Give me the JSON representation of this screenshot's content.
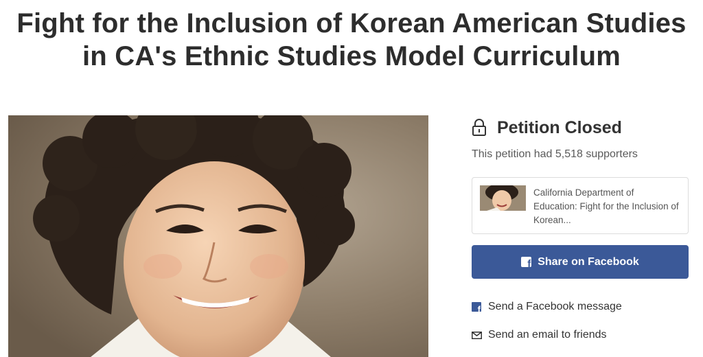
{
  "page": {
    "title_line_1": "Fight for the Inclusion of Korean American Studies",
    "title_line_2": "in CA's Ethnic Studies Model Curriculum"
  },
  "hero": {
    "image": "vintage portrait photo of a smiling young woman with dark curly hair"
  },
  "status": {
    "icon": "lock-icon",
    "label": "Petition Closed",
    "supporters_text": "This petition had 5,518 supporters"
  },
  "share_card": {
    "line_1": "California Department of",
    "line_2": "Education: Fight for the Inclusion of",
    "line_3": "Korean..."
  },
  "share": {
    "facebook_button": "Share on Facebook",
    "facebook_message": "Send a Facebook message",
    "email_friends": "Send an email to friends"
  },
  "colors": {
    "facebook_blue": "#3b5998",
    "title_text": "#2d2d2d",
    "body_text": "#333333",
    "muted_text": "#5a5a5a",
    "card_border": "#dcdcdc"
  }
}
